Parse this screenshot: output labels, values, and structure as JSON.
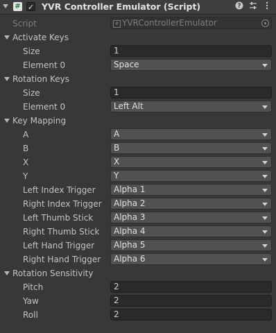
{
  "component": {
    "title": "YVR Controller Emulator (Script)",
    "enabled": true,
    "icons": [
      "fold-arrow-icon",
      "script-icon",
      "help-icon",
      "presets-icon",
      "kebab-menu-icon"
    ]
  },
  "script_field": {
    "label": "Script",
    "value": "YVRControllerEmulator"
  },
  "activate_keys": {
    "label": "Activate Keys",
    "size_label": "Size",
    "size_value": "1",
    "element0_label": "Element 0",
    "element0_value": "Space"
  },
  "rotation_keys": {
    "label": "Rotation Keys",
    "size_label": "Size",
    "size_value": "1",
    "element0_label": "Element 0",
    "element0_value": "Left Alt"
  },
  "key_mapping": {
    "label": "Key Mapping",
    "items": [
      {
        "label": "A",
        "value": "A"
      },
      {
        "label": "B",
        "value": "B"
      },
      {
        "label": "X",
        "value": "X"
      },
      {
        "label": "Y",
        "value": "Y"
      },
      {
        "label": "Left Index Trigger",
        "value": "Alpha 1"
      },
      {
        "label": "Right Index Trigger",
        "value": "Alpha 2"
      },
      {
        "label": "Left Thumb Stick",
        "value": "Alpha 3"
      },
      {
        "label": "Right Thumb Stick",
        "value": "Alpha 4"
      },
      {
        "label": "Left Hand Trigger",
        "value": "Alpha 5"
      },
      {
        "label": "Right Hand Trigger",
        "value": "Alpha 6"
      }
    ]
  },
  "rotation_sensitivity": {
    "label": "Rotation Sensitivity",
    "items": [
      {
        "label": "Pitch",
        "value": "2"
      },
      {
        "label": "Yaw",
        "value": "2"
      },
      {
        "label": "Roll",
        "value": "2"
      }
    ]
  },
  "colors": {
    "background": "#383838",
    "header": "#3e3e3e",
    "field": "#2a2a2a",
    "dropdown": "#515151",
    "text": "#c4c4c4"
  }
}
